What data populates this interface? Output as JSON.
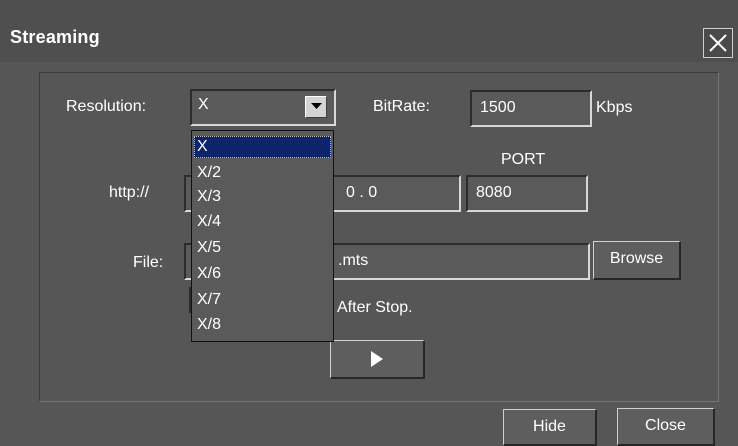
{
  "window": {
    "title": "Streaming",
    "close_icon": "close-icon"
  },
  "resolution": {
    "label": "Resolution:",
    "value": "X",
    "options": [
      "X",
      "X/2",
      "X/3",
      "X/4",
      "X/5",
      "X/6",
      "X/7",
      "X/8"
    ],
    "selected_index": 0
  },
  "bitrate": {
    "label": "BitRate:",
    "value": "1500",
    "unit": "Kbps"
  },
  "url": {
    "label": "http://",
    "ip_visible": "0  .  0",
    "port_label": "PORT",
    "port_value": "8080"
  },
  "file": {
    "label": "File:",
    "value": ".mts",
    "browse_label": "Browse"
  },
  "checkbox": {
    "label": "After Stop."
  },
  "play_icon": "play-icon",
  "buttons": {
    "hide": "Hide",
    "close": "Close"
  },
  "colors": {
    "background": "#565656",
    "selection": "#0d246a",
    "text": "#ffffff"
  }
}
